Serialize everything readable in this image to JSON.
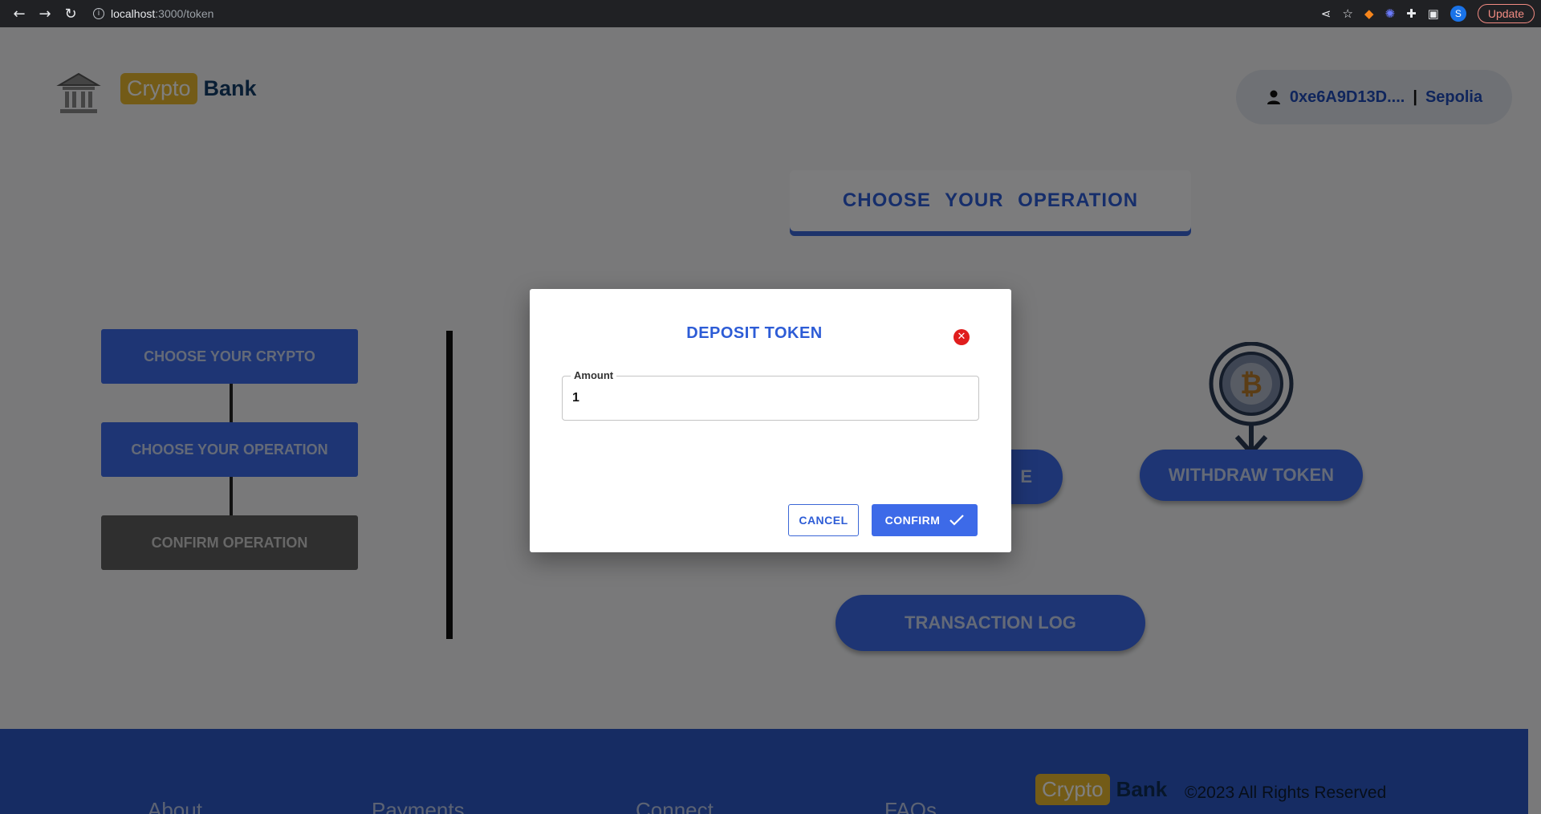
{
  "browser": {
    "url_host": "localhost",
    "url_path": ":3000/token",
    "update_label": "Update",
    "profile_initial": "S"
  },
  "header": {
    "brand_crypto": "Crypto",
    "brand_bank": "Bank",
    "account_address": "0xe6A9D13D....",
    "account_separator": "|",
    "network": "Sepolia"
  },
  "main": {
    "operation_header": "CHOOSE YOUR OPERATION",
    "steps": [
      {
        "label": "CHOOSE YOUR CRYPTO"
      },
      {
        "label": "CHOOSE YOUR OPERATION"
      },
      {
        "label": "CONFIRM OPERATION"
      }
    ],
    "deposit_partial_label": "E",
    "withdraw_label": "WITHDRAW TOKEN",
    "transaction_log_label": "TRANSACTION LOG"
  },
  "footer": {
    "columns": [
      "About",
      "Payments",
      "Connect",
      "FAQs"
    ],
    "brand_crypto": "Crypto",
    "brand_bank": "Bank",
    "copyright": "©2023 All Rights Reserved"
  },
  "dialog": {
    "title": "DEPOSIT TOKEN",
    "amount_label": "Amount",
    "amount_value": "1",
    "cancel_label": "CANCEL",
    "confirm_label": "CONFIRM"
  },
  "colors": {
    "accent": "#3d6ae8",
    "brand_yellow": "#e6b62e",
    "close_red": "#e01d1d"
  }
}
